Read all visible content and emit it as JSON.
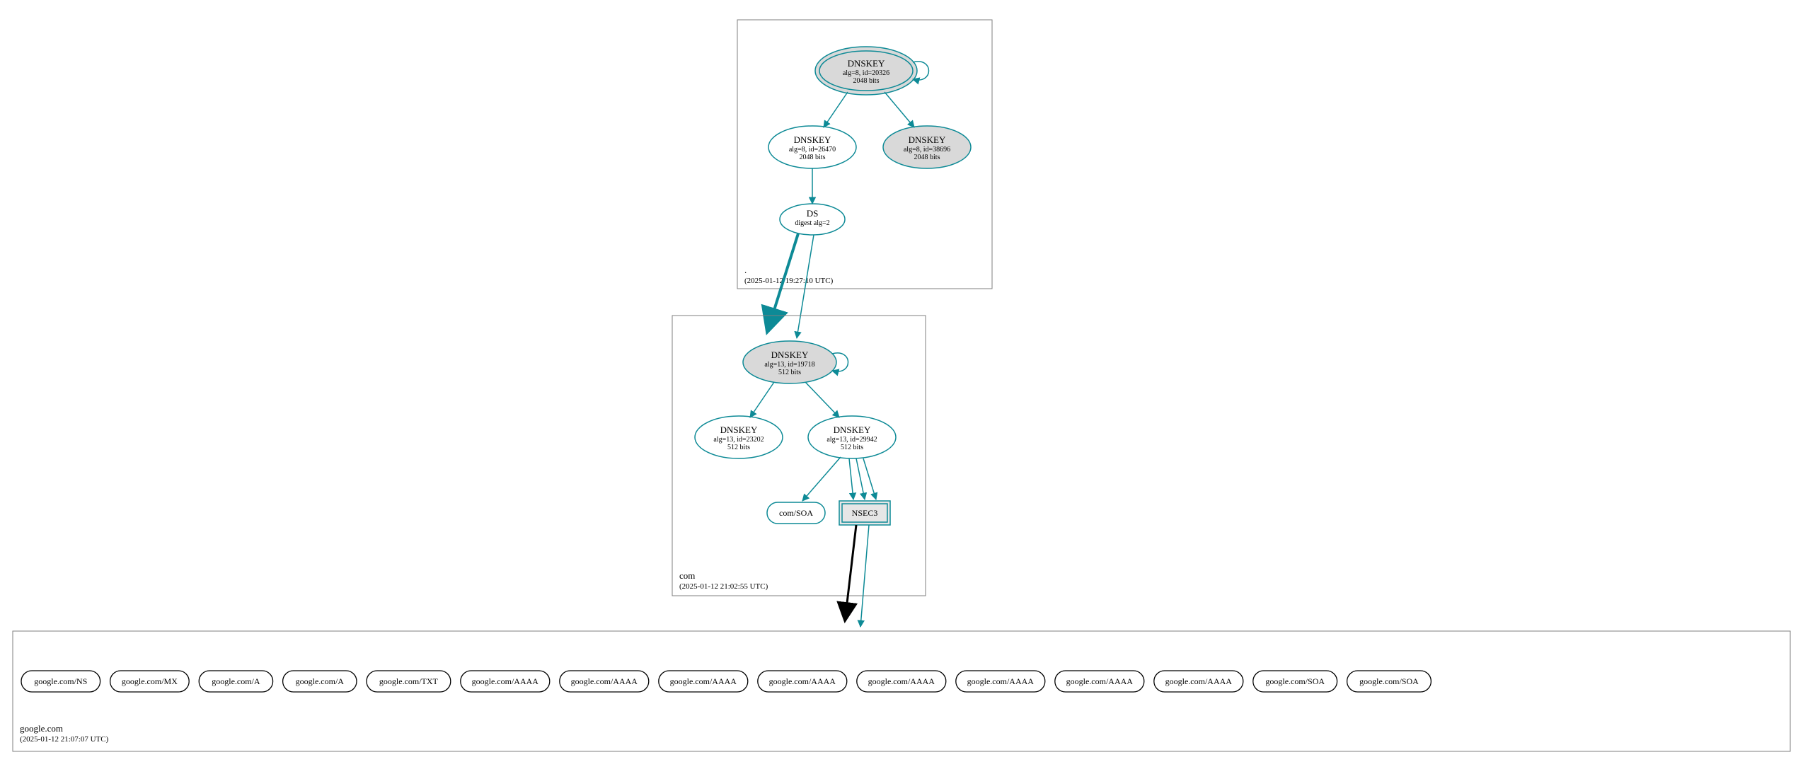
{
  "colors": {
    "teal": "#0d8a96",
    "grayFill": "#d9d9d9",
    "lightGrayFill": "#e6e6e6",
    "black": "#000000",
    "white": "#ffffff"
  },
  "zones": {
    "root": {
      "name": ".",
      "timestamp": "(2025-01-12 19:27:10 UTC)",
      "nodes": {
        "ksk": {
          "title": "DNSKEY",
          "line2": "alg=8, id=20326",
          "line3": "2048 bits"
        },
        "zsk1": {
          "title": "DNSKEY",
          "line2": "alg=8, id=26470",
          "line3": "2048 bits"
        },
        "zsk2": {
          "title": "DNSKEY",
          "line2": "alg=8, id=38696",
          "line3": "2048 bits"
        },
        "ds": {
          "title": "DS",
          "line2": "digest alg=2"
        }
      }
    },
    "com": {
      "name": "com",
      "timestamp": "(2025-01-12 21:02:55 UTC)",
      "nodes": {
        "ksk": {
          "title": "DNSKEY",
          "line2": "alg=13, id=19718",
          "line3": "512 bits"
        },
        "zsk1": {
          "title": "DNSKEY",
          "line2": "alg=13, id=23202",
          "line3": "512 bits"
        },
        "zsk2": {
          "title": "DNSKEY",
          "line2": "alg=13, id=29942",
          "line3": "512 bits"
        },
        "soa": {
          "label": "com/SOA"
        },
        "nsec3": {
          "label": "NSEC3"
        }
      }
    },
    "google": {
      "name": "google.com",
      "timestamp": "(2025-01-12 21:07:07 UTC)",
      "records": [
        "google.com/NS",
        "google.com/MX",
        "google.com/A",
        "google.com/A",
        "google.com/TXT",
        "google.com/AAAA",
        "google.com/AAAA",
        "google.com/AAAA",
        "google.com/AAAA",
        "google.com/AAAA",
        "google.com/AAAA",
        "google.com/AAAA",
        "google.com/AAAA",
        "google.com/SOA",
        "google.com/SOA"
      ]
    }
  }
}
